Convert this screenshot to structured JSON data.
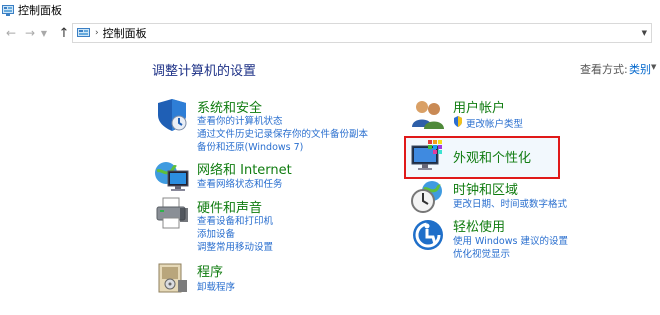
{
  "window": {
    "title": "控制面板"
  },
  "address": {
    "path": "控制面板"
  },
  "main": {
    "heading": "调整计算机的设置",
    "view_by_label": "查看方式:",
    "view_by_value": "类别"
  },
  "categories": {
    "system_security": {
      "title": "系统和安全",
      "links": [
        "查看你的计算机状态",
        "通过文件历史记录保存你的文件备份副本",
        "备份和还原(Windows 7)"
      ]
    },
    "network": {
      "title": "网络和 Internet",
      "links": [
        "查看网络状态和任务"
      ]
    },
    "hardware": {
      "title": "硬件和声音",
      "links": [
        "查看设备和打印机",
        "添加设备",
        "调整常用移动设置"
      ]
    },
    "programs": {
      "title": "程序",
      "links": [
        "卸载程序"
      ]
    },
    "user_accounts": {
      "title": "用户帐户",
      "links": [
        "更改帐户类型"
      ]
    },
    "appearance": {
      "title": "外观和个性化",
      "links": []
    },
    "clock_region": {
      "title": "时钟和区域",
      "links": [
        "更改日期、时间或数字格式"
      ]
    },
    "ease_access": {
      "title": "轻松使用",
      "links": [
        "使用 Windows 建议的设置",
        "优化视觉显示"
      ]
    }
  },
  "colors": {
    "category_title": "#107c10",
    "link": "#2a6fcf",
    "heading": "#1e3287",
    "highlight_border": "#e01919"
  },
  "icons": {
    "back": "arrow-left-icon",
    "forward": "arrow-right-icon",
    "up": "arrow-up-icon",
    "system_security": "shield-icon",
    "network": "globe-monitor-icon",
    "hardware": "printer-icon",
    "programs": "program-box-icon",
    "user_accounts": "users-icon",
    "appearance": "monitor-palette-icon",
    "clock_region": "clock-globe-icon",
    "ease_access": "accessibility-icon"
  }
}
